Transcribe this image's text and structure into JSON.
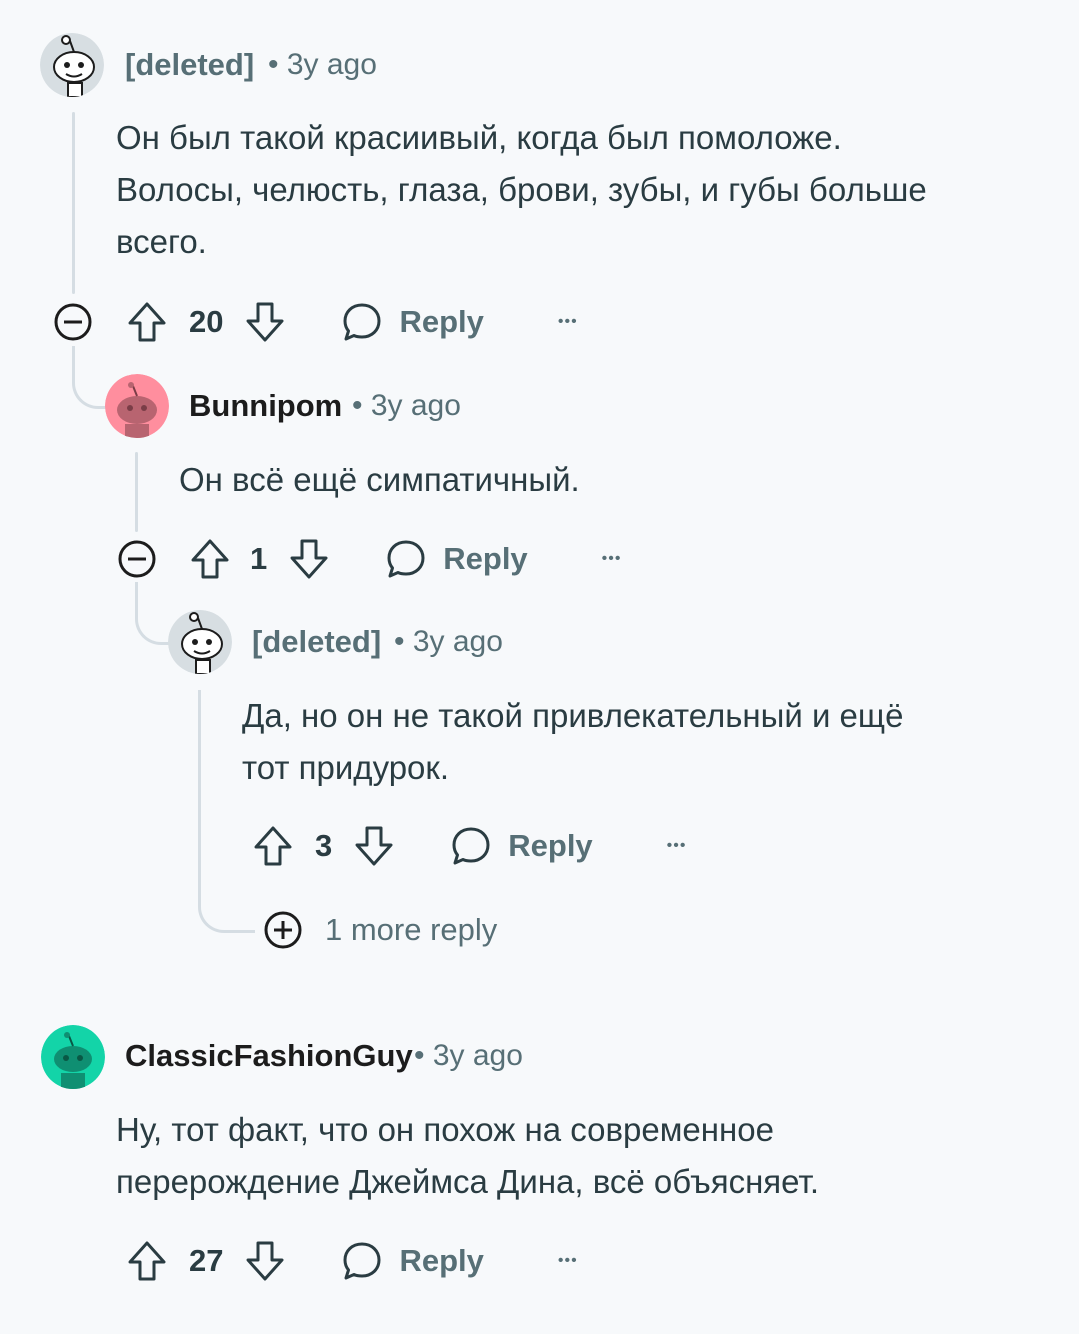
{
  "comments": [
    {
      "author": "[deleted]",
      "meta": "• 3y ago",
      "body": [
        "Он был такой красиивый, когда был помоложе.",
        "Волосы, челюсть, глаза, брови, зубы, и губы больше",
        "всего."
      ],
      "score": "20",
      "reply_label": "Reply",
      "more_label": "•••",
      "avatar_color": "#c9d2d6"
    },
    {
      "author": "Bunnipom",
      "meta": "• 3y ago",
      "body": [
        "Он всё ещё симпатичный."
      ],
      "score": "1",
      "reply_label": "Reply",
      "more_label": "•••",
      "avatar_color": "#ff8e9e"
    },
    {
      "author": "[deleted]",
      "meta": "• 3y ago",
      "body": [
        "Да, но он не такой привлекательный и ещё",
        "тот придурок."
      ],
      "score": "3",
      "reply_label": "Reply",
      "more_label": "•••",
      "avatar_color": "#c9d2d6",
      "more_replies": "1 more reply"
    },
    {
      "author": "ClassicFashionGuy",
      "meta": "• 3y ago",
      "body": [
        "Ну, тот факт, что он похож на современное",
        "перерождение Джеймса Дина, всё объясняет."
      ],
      "score": "27",
      "reply_label": "Reply",
      "more_label": "•••",
      "avatar_color": "#13d4a8"
    }
  ],
  "colors": {
    "background": "#f7f9fb",
    "thread_line": "#d5dde3",
    "muted_text": "#576f76",
    "body_text": "#2a3c42"
  }
}
